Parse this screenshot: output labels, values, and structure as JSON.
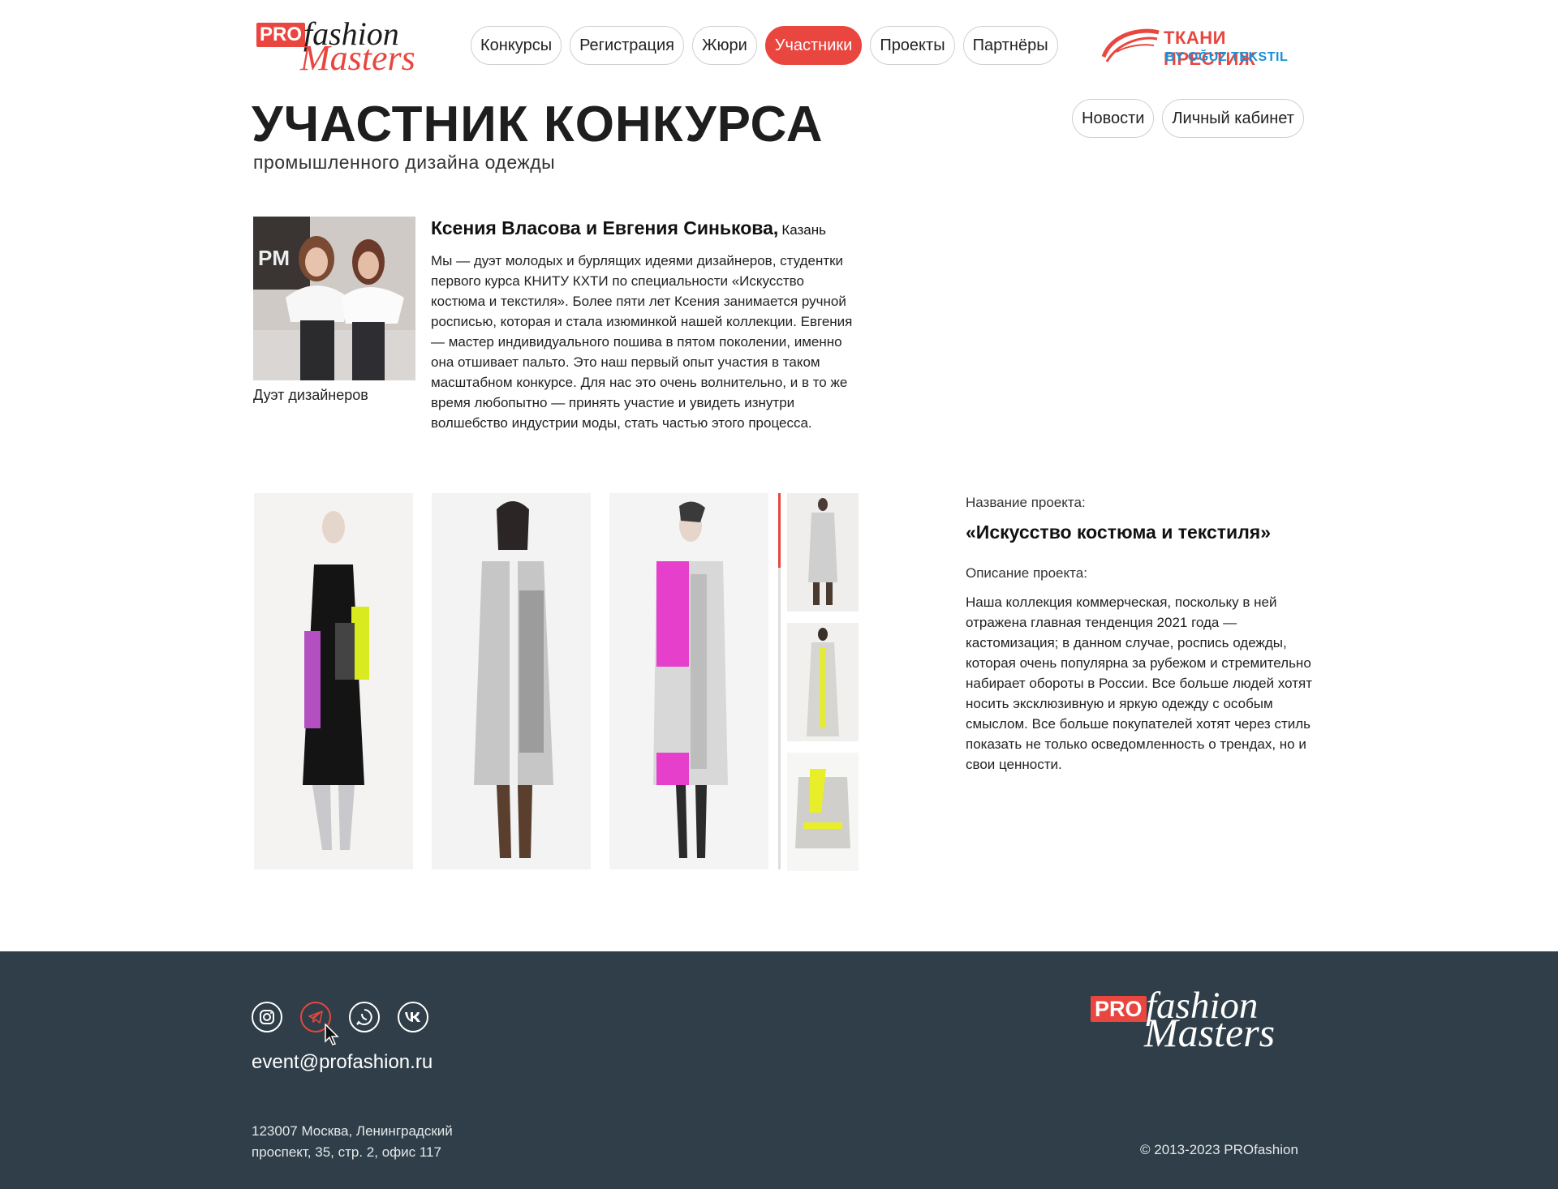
{
  "brand": {
    "pro": "PRO",
    "fashion": "fashion",
    "masters": "Masters"
  },
  "nav": {
    "items": [
      "Конкурсы",
      "Регистрация",
      "Жюри",
      "Участники",
      "Проекты",
      "Партнёры"
    ],
    "active": 3
  },
  "partner": {
    "name": "ТКАНИ ПРЕСТИЖ",
    "by": "BY OĞUZ TEKSTIL"
  },
  "side_nav": [
    "Новости",
    "Личный кабинет"
  ],
  "page": {
    "title": "УЧАСТНИК КОНКУРСА",
    "subtitle": "промышленного дизайна одежды"
  },
  "participant": {
    "name": "Ксения Власова и Евгения Синькова,",
    "city": "Казань",
    "photo_caption": "Дуэт дизайнеров",
    "bio": "Мы — дуэт молодых и бурлящих идеями дизайнеров, студентки первого курса КНИТУ КХТИ по специальности «Искусство костюма и текстиля». Более пяти лет Ксения занимается ручной росписью, которая и стала изюминкой нашей коллекции. Евгения — мастер индивидуального пошива в пятом поколении, именно она отшивает пальто. Это наш первый опыт участия в таком масштабном конкурсе. Для нас это очень волнительно, и в то же время любопытно — принять участие и увидеть изнутри волшебство индустрии моды, стать частью этого процесса."
  },
  "project": {
    "title_label": "Название проекта:",
    "title": "«Искусство костюма и текстиля»",
    "desc_label": "Описание проекта:",
    "desc": "Наша коллекция коммерческая, поскольку в ней отражена главная тенденция 2021 года — кастомизация; в данном случае, роспись одежды, которая очень популярна за рубежом и стремительно набирает обороты в России. Все больше людей хотят носить эксклюзивную и яркую одежду с особым смыслом. Все больше покупателей хотят через стиль показать не только осведомленность о трендах, но и свои ценности."
  },
  "footer": {
    "email": "event@profashion.ru",
    "address_line1": "123007 Москва, Ленинградский",
    "address_line2": "проспект, 35, стр. 2, офис 117",
    "copyright": "© 2013-2023 PROfashion"
  },
  "colors": {
    "accent": "#e8463f",
    "footer_bg": "#2f3e48",
    "partner_blue": "#1a8fd6"
  }
}
